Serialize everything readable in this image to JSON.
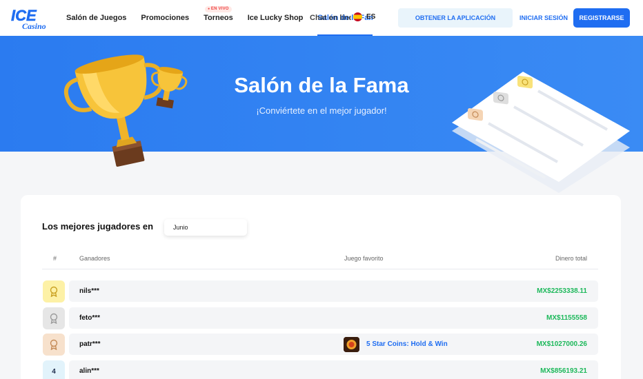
{
  "header": {
    "logo": {
      "text_top": "ICE",
      "text_bottom": "Casino"
    },
    "nav": [
      {
        "label": "Salón de Juegos"
      },
      {
        "label": "Promociones"
      },
      {
        "label": "Torneos",
        "badge": "EN VIVO"
      },
      {
        "label": "Ice Lucky Shop"
      },
      {
        "label": "Salón de la Fama",
        "active": true
      },
      {
        "label": "Chat en línea"
      }
    ],
    "language": {
      "code": "ES",
      "icon": "spain-flag-icon"
    },
    "get_app_label": "OBTENER LA APLICACIÓN",
    "login_label": "INICIAR SESIÓN",
    "register_label": "REGISTRARSE"
  },
  "hero": {
    "title": "Salón de la Fama",
    "subtitle": "¡Conviértete en el mejor jugador!",
    "icons": [
      "gold-trophy-icon",
      "small-trophy-icon",
      "leaderboard-illustration-icon"
    ]
  },
  "leaderboard": {
    "title": "Los mejores jugadores en",
    "month": "Junio",
    "columns": {
      "rank": "#",
      "winners": "Ganadores",
      "favorite_game": "Juego favorito",
      "total_money": "Dinero total"
    },
    "rows": [
      {
        "rank": "",
        "medal": "gold",
        "player": "nils***",
        "game": "",
        "money": "MX$2253338.11"
      },
      {
        "rank": "",
        "medal": "silver",
        "player": "feto***",
        "game": "",
        "money": "MX$1155558"
      },
      {
        "rank": "",
        "medal": "bronze",
        "player": "patr***",
        "game": "5 Star Coins: Hold & Win",
        "money": "MX$1027000.26"
      },
      {
        "rank": "4",
        "medal": "none",
        "player": "alin***",
        "game": "",
        "money": "MX$856193.21"
      }
    ]
  },
  "colors": {
    "brand_blue": "#1f6df1",
    "hero_blue": "#2b7bf0",
    "money_green": "#1cb85a",
    "gold": "#fdf1a6",
    "silver": "#e6e6e6",
    "bronze": "#f7e1cc",
    "rank_plain": "#e2f3fb"
  }
}
